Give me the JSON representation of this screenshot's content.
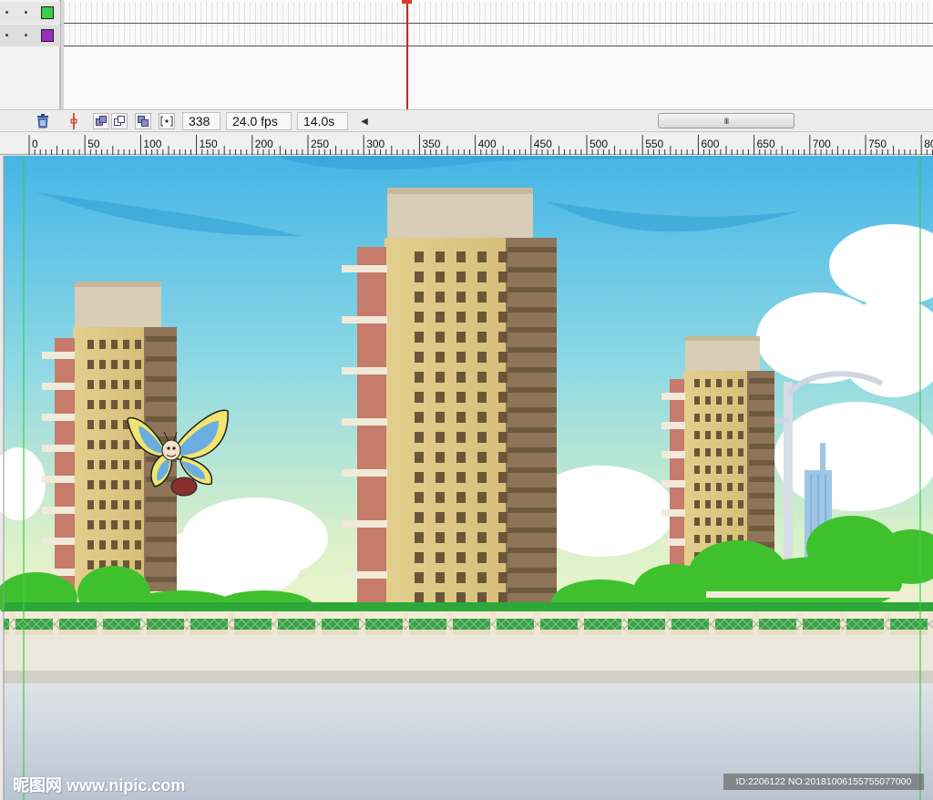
{
  "timeline": {
    "layers": [
      {
        "color": "#3ecb4a"
      },
      {
        "color": "#9a2cc0"
      }
    ],
    "current_frame": "338",
    "frame_rate": "24.0 fps",
    "elapsed_time": "14.0s",
    "scroll_thumb": "III"
  },
  "ruler": {
    "labels": [
      "0",
      "50",
      "100",
      "150",
      "200",
      "250",
      "300",
      "350",
      "400",
      "450",
      "500",
      "550",
      "600",
      "650",
      "700",
      "750",
      "80"
    ]
  },
  "colors": {
    "sky_top": "#49b8e6",
    "sky_mid": "#8fd8e6",
    "sky_bottom": "#e6f2c4",
    "building": "#e0cd8e",
    "building_side": "#8e7458",
    "tree": "#3fc12e",
    "guide": "#3ecb4a",
    "playhead": "#c8281e"
  },
  "watermark": {
    "left": "昵图网 www.nipic.com",
    "right": "ID:2206122 NO:20181006155755077000"
  }
}
